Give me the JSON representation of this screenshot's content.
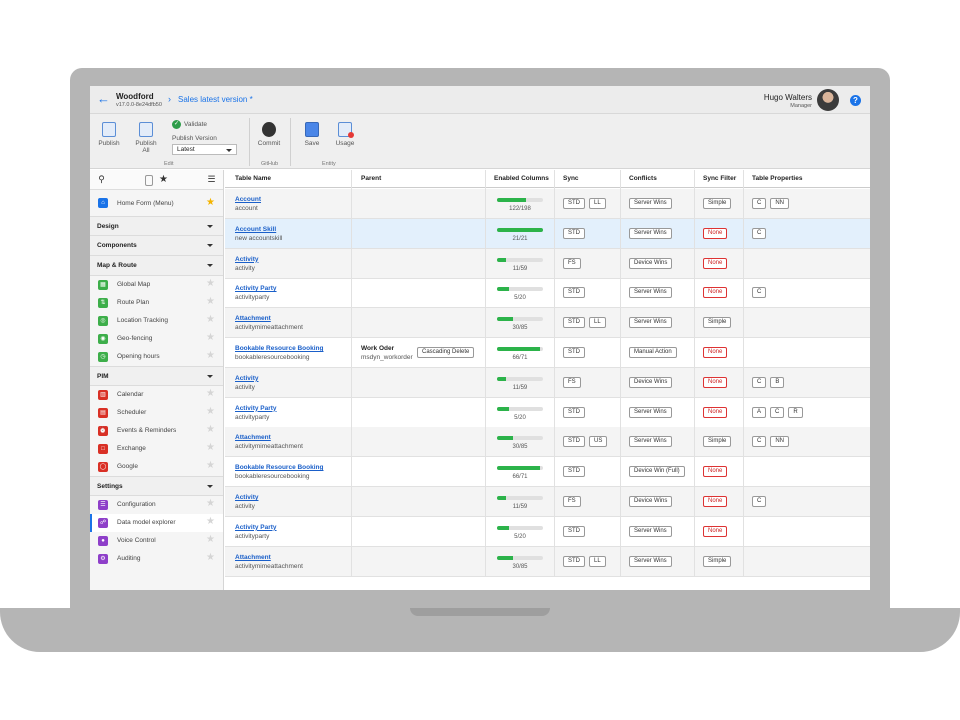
{
  "header": {
    "app_name": "Woodford",
    "app_version": "v17.0.0-8e24dfb50",
    "breadcrumb_sep": "›",
    "project_title": "Sales latest version *",
    "user_name": "Hugo Walters",
    "user_role": "Manager",
    "help_label": "?"
  },
  "ribbon": {
    "publish": "Publish",
    "publish_all_1": "Publish",
    "publish_all_2": "All",
    "validate": "Validate",
    "publish_version_label": "Publish Version",
    "publish_version_value": "Latest",
    "group_edit": "Edit",
    "commit": "Commit",
    "group_github": "GitHub",
    "save": "Save",
    "usage": "Usage",
    "group_entity": "Entity"
  },
  "sidebar": {
    "home": "Home Form (Menu)",
    "sections": {
      "design": "Design",
      "components": "Components",
      "map_route": "Map & Route",
      "pim": "PIM",
      "settings": "Settings"
    },
    "map_items": [
      "Global Map",
      "Route Plan",
      "Location Tracking",
      "Geo-fencing",
      "Opening hours"
    ],
    "pim_items": [
      "Calendar",
      "Scheduler",
      "Events & Reminders",
      "Exchange",
      "Google"
    ],
    "settings_items": [
      "Configuration",
      "Data model explorer",
      "Voice Control",
      "Auditing"
    ]
  },
  "grid": {
    "columns": [
      "Table Name",
      "Parent",
      "Enabled Columns",
      "Sync",
      "Conflicts",
      "Sync Filter",
      "Table Properties"
    ],
    "rows": [
      {
        "name": "Account",
        "logical": "account",
        "parent": "",
        "parent_sub": "",
        "cascade": "",
        "enabled": "122/198",
        "fill": 0.62,
        "sync": [
          "STD",
          "LL"
        ],
        "conflict": "Server Wins",
        "filter": "Simple",
        "filter_red": false,
        "props": [
          "C",
          "NN"
        ]
      },
      {
        "name": "Account Skill",
        "logical": "new accountskill",
        "parent": "",
        "parent_sub": "",
        "cascade": "",
        "enabled": "21/21",
        "fill": 1.0,
        "sync": [
          "STD"
        ],
        "conflict": "Server Wins",
        "filter": "None",
        "filter_red": true,
        "props": [
          "C"
        ]
      },
      {
        "name": "Activity",
        "logical": "activity",
        "parent": "",
        "parent_sub": "",
        "cascade": "",
        "enabled": "11/59",
        "fill": 0.19,
        "sync": [
          "FS"
        ],
        "conflict": "Device Wins",
        "filter": "None",
        "filter_red": true,
        "props": []
      },
      {
        "name": "Activity Party",
        "logical": "activityparty",
        "parent": "",
        "parent_sub": "",
        "cascade": "",
        "enabled": "5/20",
        "fill": 0.25,
        "sync": [
          "STD"
        ],
        "conflict": "Server Wins",
        "filter": "None",
        "filter_red": true,
        "props": [
          "C"
        ]
      },
      {
        "name": "Attachment",
        "logical": "activitymimeattachment",
        "parent": "",
        "parent_sub": "",
        "cascade": "",
        "enabled": "30/85",
        "fill": 0.35,
        "sync": [
          "STD",
          "LL"
        ],
        "conflict": "Server Wins",
        "filter": "Simple",
        "filter_red": false,
        "props": []
      },
      {
        "name": "Bookable Resource Booking",
        "logical": "bookableresourcebooking",
        "parent": "Work Oder",
        "parent_sub": "msdyn_workorder",
        "cascade": "Cascading Delete",
        "enabled": "66/71",
        "fill": 0.93,
        "sync": [
          "STD"
        ],
        "conflict": "Manual Action",
        "filter": "None",
        "filter_red": true,
        "props": []
      },
      {
        "name": "Activity",
        "logical": "activity",
        "parent": "",
        "parent_sub": "",
        "cascade": "",
        "enabled": "11/59",
        "fill": 0.19,
        "sync": [
          "FS"
        ],
        "conflict": "Device Wins",
        "filter": "None",
        "filter_red": true,
        "props": [
          "C",
          "B"
        ]
      },
      {
        "name": "Activity Party",
        "logical": "activityparty",
        "parent": "",
        "parent_sub": "",
        "cascade": "",
        "enabled": "5/20",
        "fill": 0.25,
        "sync": [
          "STD"
        ],
        "conflict": "Server Wins",
        "filter": "None",
        "filter_red": true,
        "props": [
          "A",
          "C",
          "R"
        ]
      },
      {
        "name": "Attachment",
        "logical": "activitymimeattachment",
        "parent": "",
        "parent_sub": "",
        "cascade": "",
        "enabled": "30/85",
        "fill": 0.35,
        "sync": [
          "STD",
          "US"
        ],
        "conflict": "Server Wins",
        "filter": "Simple",
        "filter_red": false,
        "props": [
          "C",
          "NN"
        ]
      },
      {
        "name": "Bookable Resource Booking",
        "logical": "bookableresourcebooking",
        "parent": "",
        "parent_sub": "",
        "cascade": "",
        "enabled": "66/71",
        "fill": 0.93,
        "sync": [
          "STD"
        ],
        "conflict": "Device Win (Full)",
        "filter": "None",
        "filter_red": true,
        "props": []
      },
      {
        "name": "Activity",
        "logical": "activity",
        "parent": "",
        "parent_sub": "",
        "cascade": "",
        "enabled": "11/59",
        "fill": 0.19,
        "sync": [
          "FS"
        ],
        "conflict": "Device Wins",
        "filter": "None",
        "filter_red": true,
        "props": [
          "C"
        ]
      },
      {
        "name": "Activity Party",
        "logical": "activityparty",
        "parent": "",
        "parent_sub": "",
        "cascade": "",
        "enabled": "5/20",
        "fill": 0.25,
        "sync": [
          "STD"
        ],
        "conflict": "Server Wins",
        "filter": "None",
        "filter_red": true,
        "props": []
      },
      {
        "name": "Attachment",
        "logical": "activitymimeattachment",
        "parent": "",
        "parent_sub": "",
        "cascade": "",
        "enabled": "30/85",
        "fill": 0.35,
        "sync": [
          "STD",
          "LL"
        ],
        "conflict": "Server Wins",
        "filter": "Simple",
        "filter_red": false,
        "props": []
      }
    ]
  },
  "colors": {
    "accent": "#1a73e8",
    "progress": "#2cb34a",
    "danger": "#d33333",
    "star": "#f4b400"
  }
}
